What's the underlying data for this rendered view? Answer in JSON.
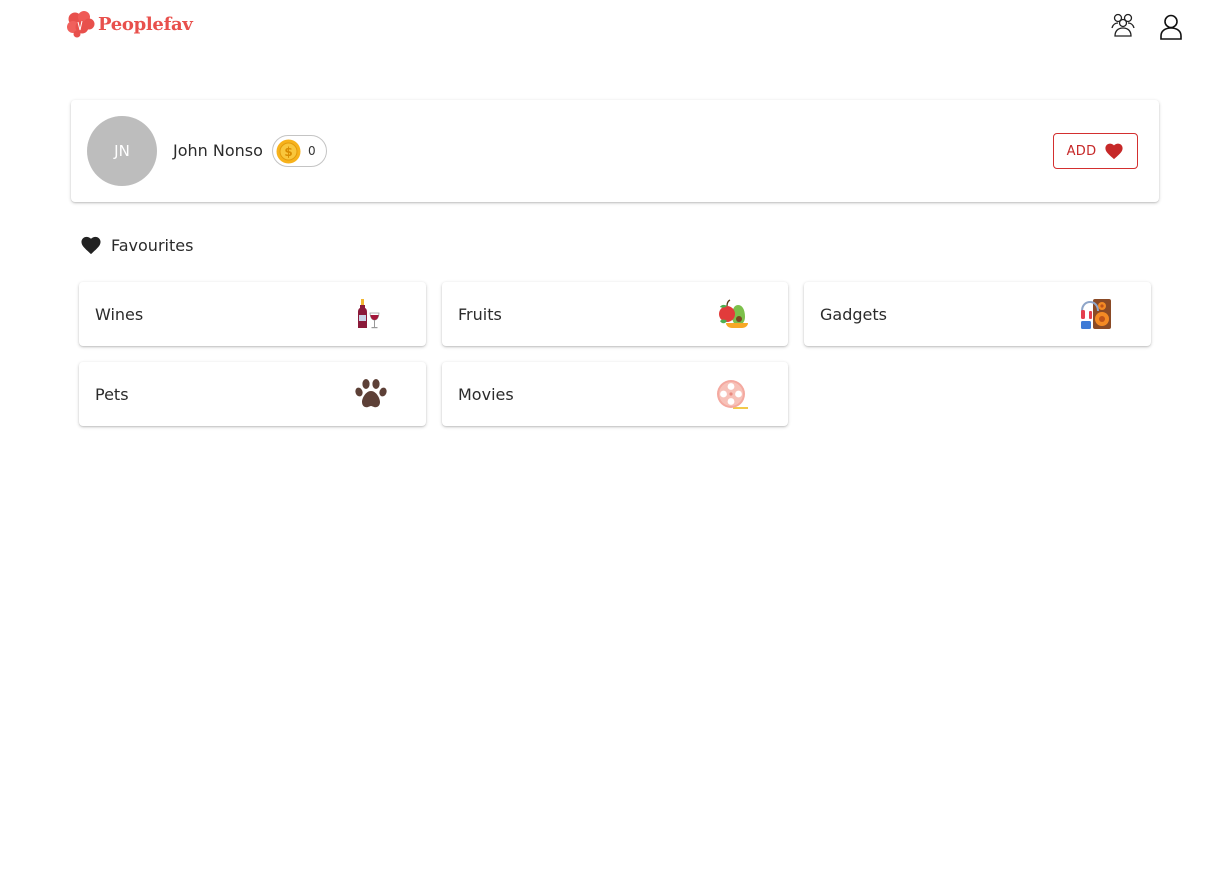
{
  "header": {
    "brand": "Peoplefav",
    "brand_color": "#e8504c",
    "icons": [
      "community-icon",
      "account-icon"
    ]
  },
  "profile": {
    "initials": "JN",
    "name": "John Nonso",
    "coins": "0",
    "add_label": "ADD",
    "accent_color": "#c62828"
  },
  "favourites": {
    "title": "Favourites",
    "categories": [
      {
        "label": "Wines",
        "icon": "wine-icon"
      },
      {
        "label": "Fruits",
        "icon": "fruits-icon"
      },
      {
        "label": "Gadgets",
        "icon": "gadgets-icon"
      },
      {
        "label": "Pets",
        "icon": "paw-icon"
      },
      {
        "label": "Movies",
        "icon": "film-reel-icon"
      }
    ]
  }
}
